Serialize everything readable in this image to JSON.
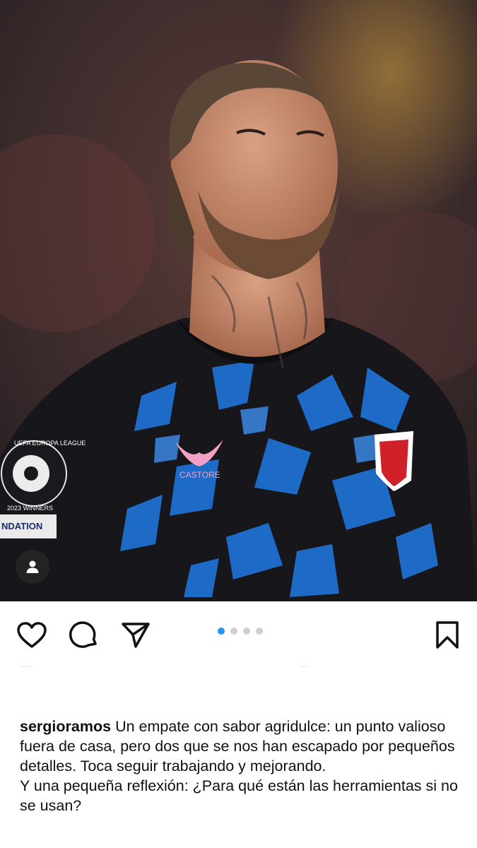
{
  "post": {
    "image_alt": "Player photo",
    "jersey_brand": "CASTORE",
    "patch_top": "UEFA EUROPA LEAGUE",
    "patch_bottom": "2023 WINNERS",
    "sleeve_text": "NDATION"
  },
  "actions": {
    "like_icon": "heart-icon",
    "comment_icon": "comment-icon",
    "share_icon": "paper-plane-icon",
    "save_icon": "bookmark-icon",
    "tag_icon": "person-icon"
  },
  "carousel": {
    "total": 4,
    "active_index": 0,
    "active_color": "#2a95f4",
    "inactive_color": "#cfcfcf"
  },
  "caption": {
    "username": "sergioramos",
    "text": "Un empate con sabor agridulce: un punto valioso fuera de casa, pero dos que se nos han escapado por pequeños detalles. Toca seguir trabajando y mejorando.",
    "second_line": "Y una pequeña reflexión: ¿Para qué están las herramientas si no se usan?"
  }
}
